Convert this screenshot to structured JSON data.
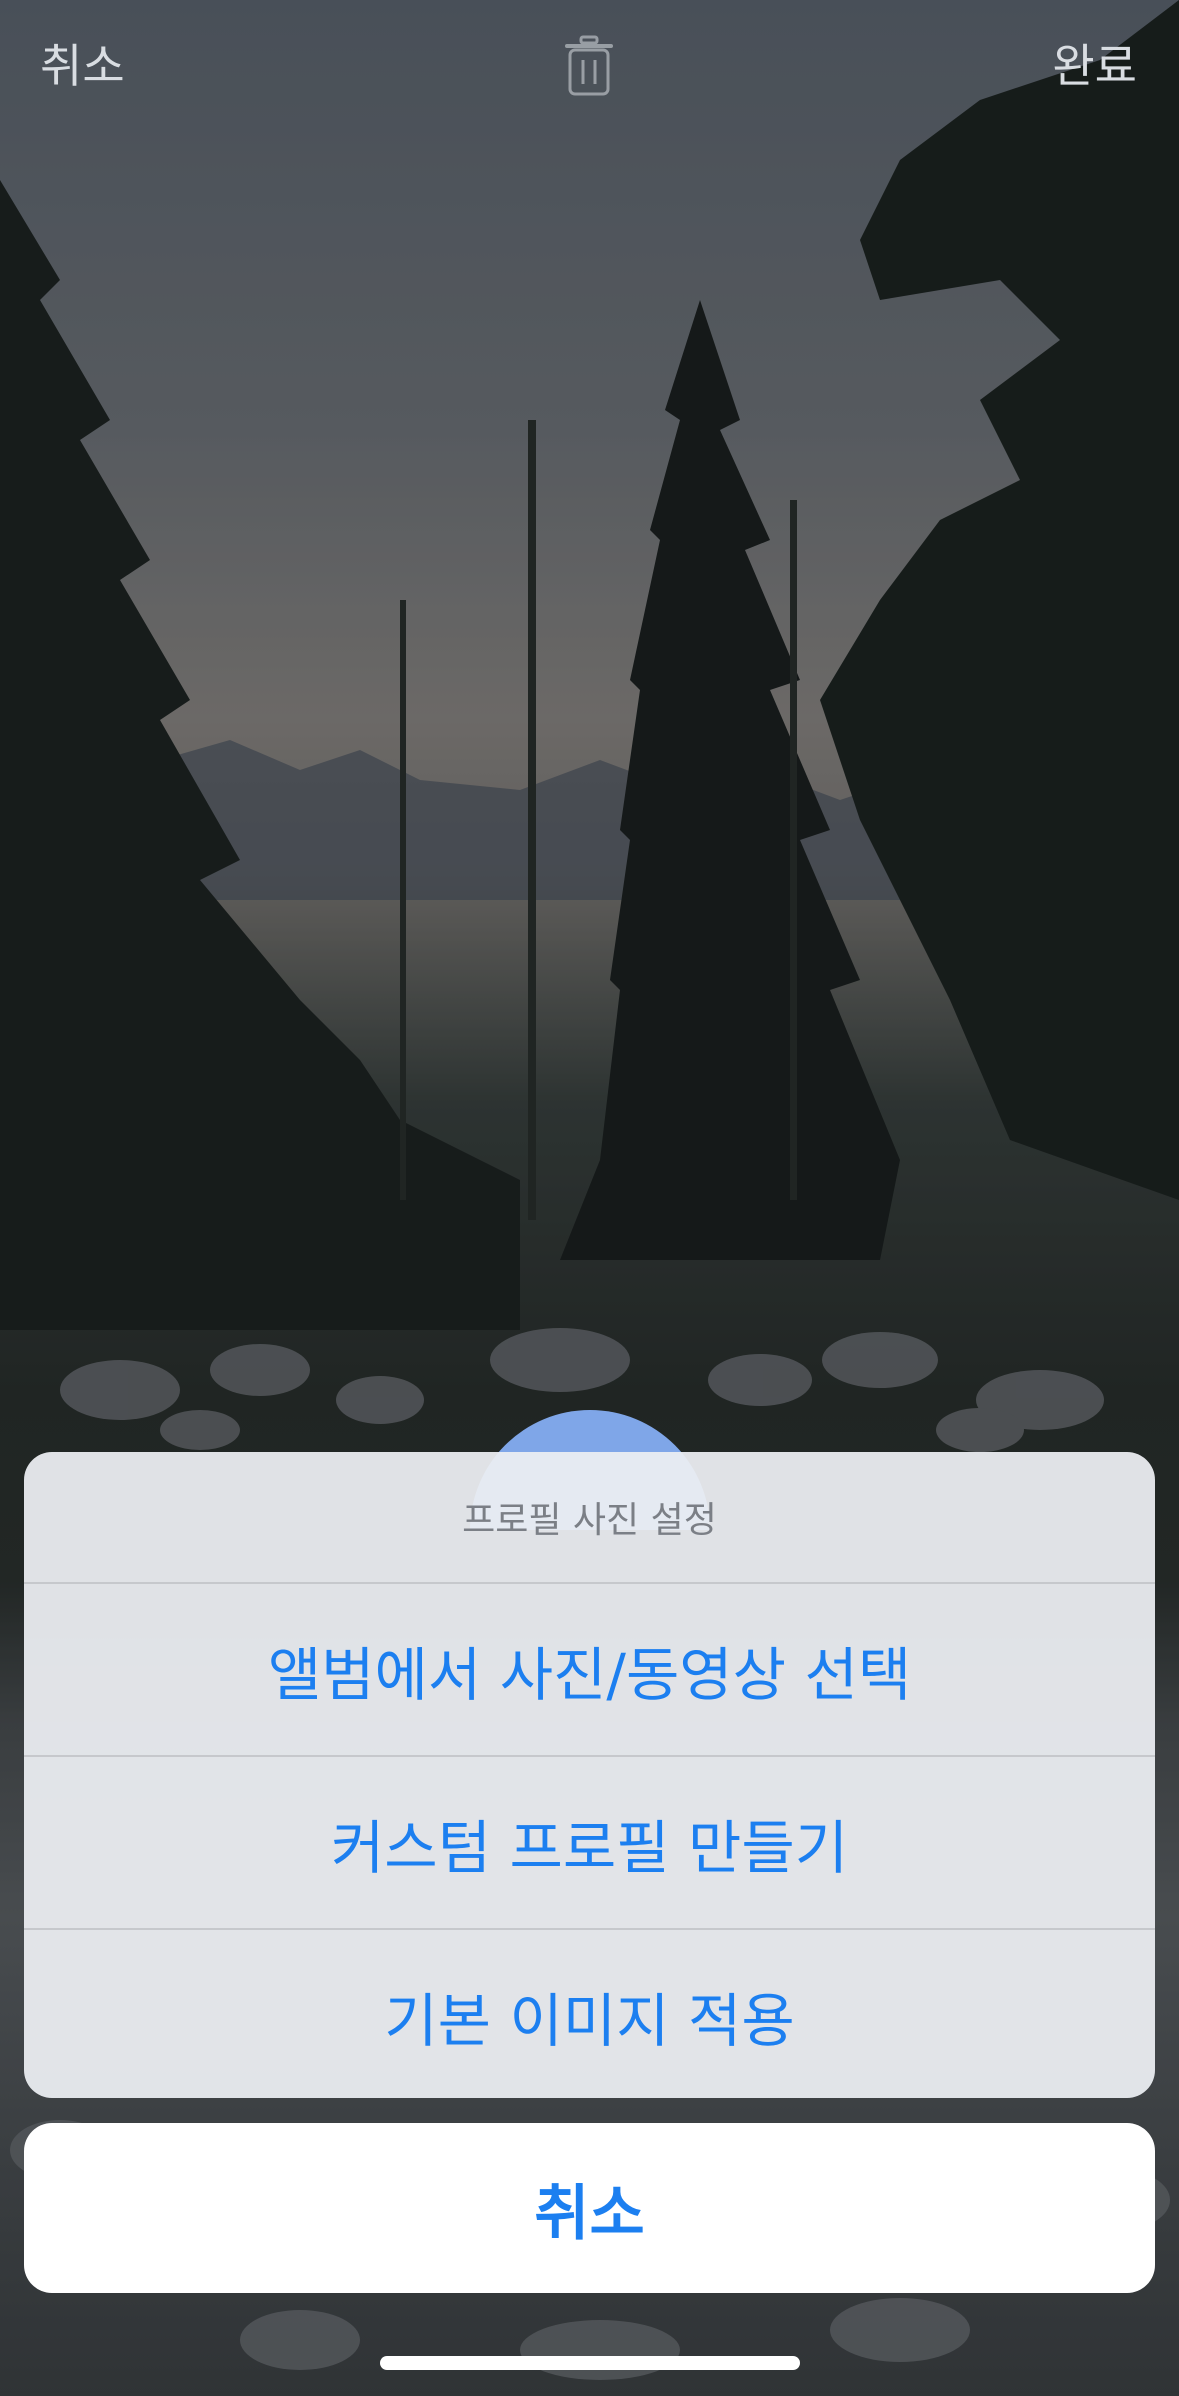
{
  "top_bar": {
    "cancel_label": "취소",
    "done_label": "완료",
    "trash_icon": "trash-icon"
  },
  "action_sheet": {
    "title": "프로필 사진 설정",
    "options": [
      {
        "label": "앨범에서 사진/동영상 선택"
      },
      {
        "label": "커스텀 프로필 만들기"
      },
      {
        "label": "기본 이미지 적용"
      }
    ],
    "cancel_label": "취소",
    "accent_color": "#1c7ff0"
  }
}
